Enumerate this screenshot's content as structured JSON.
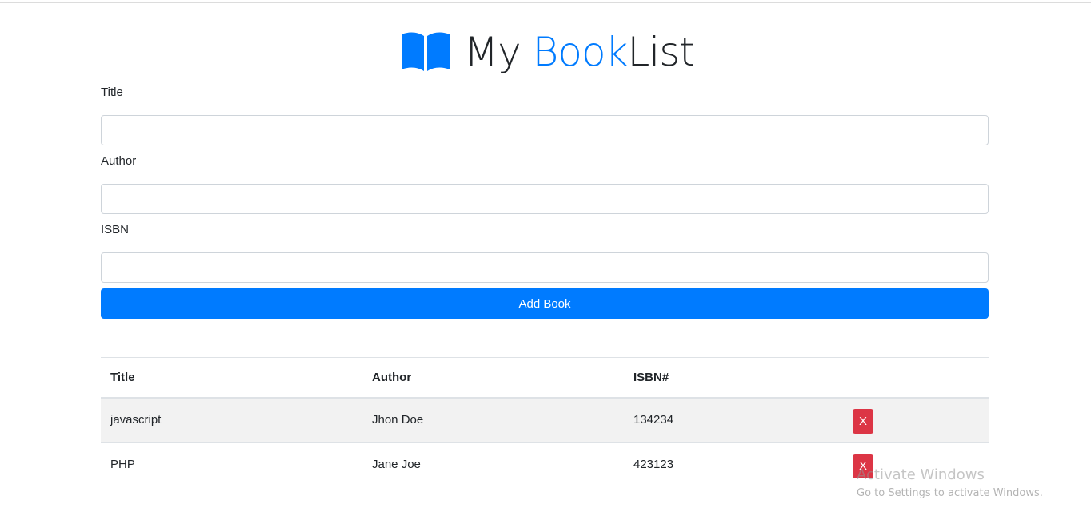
{
  "header": {
    "title_prefix": "My ",
    "title_accent": "Book",
    "title_suffix": "List",
    "icon": "book-open-icon",
    "accent_color": "#007bff"
  },
  "form": {
    "title_label": "Title",
    "title_value": "",
    "author_label": "Author",
    "author_value": "",
    "isbn_label": "ISBN",
    "isbn_value": "",
    "submit_label": "Add Book"
  },
  "table": {
    "headers": [
      "Title",
      "Author",
      "ISBN#",
      ""
    ],
    "rows": [
      {
        "title": "javascript",
        "author": "Jhon Doe",
        "isbn": "134234",
        "delete_label": "X"
      },
      {
        "title": "PHP",
        "author": "Jane Joe",
        "isbn": "423123",
        "delete_label": "X"
      }
    ]
  },
  "watermark": {
    "title": "Activate Windows",
    "subtitle": "Go to Settings to activate Windows."
  },
  "colors": {
    "primary": "#007bff",
    "danger": "#dc3545",
    "stripe": "#f2f2f2"
  }
}
